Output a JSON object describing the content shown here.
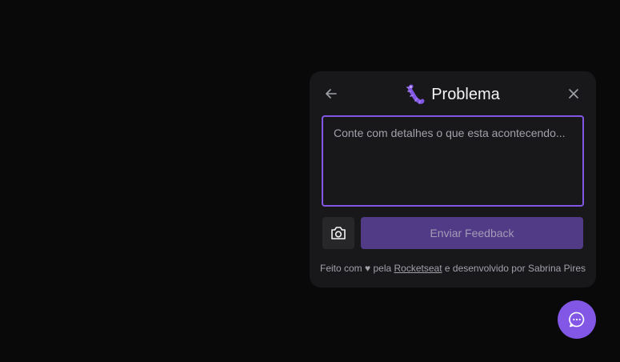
{
  "colors": {
    "page_background": "#09090a",
    "widget_background": "#18181b",
    "brand": "#8257e5",
    "button_disabled": "#513a86",
    "surface_secondary": "#27272a",
    "text_primary": "#f4f4f5",
    "text_secondary": "#a1a1aa"
  },
  "feedback_widget": {
    "header": {
      "back_icon": "arrow-left-icon",
      "title_icon": "bug-icon",
      "title": "Problema",
      "close_icon": "close-icon"
    },
    "comment": {
      "placeholder": "Conte com detalhes o que esta acontecendo..."
    },
    "screenshot_button_icon": "camera-icon",
    "submit_label": "Enviar Feedback",
    "footer": {
      "prefix": "Feito com",
      "heart_glyph": "♥",
      "middle": "pela",
      "link_text": "Rocketseat",
      "suffix": "e desenvolvido por Sabrina Pires"
    }
  },
  "chat_fab": {
    "icon": "chat-bubble-icon"
  }
}
